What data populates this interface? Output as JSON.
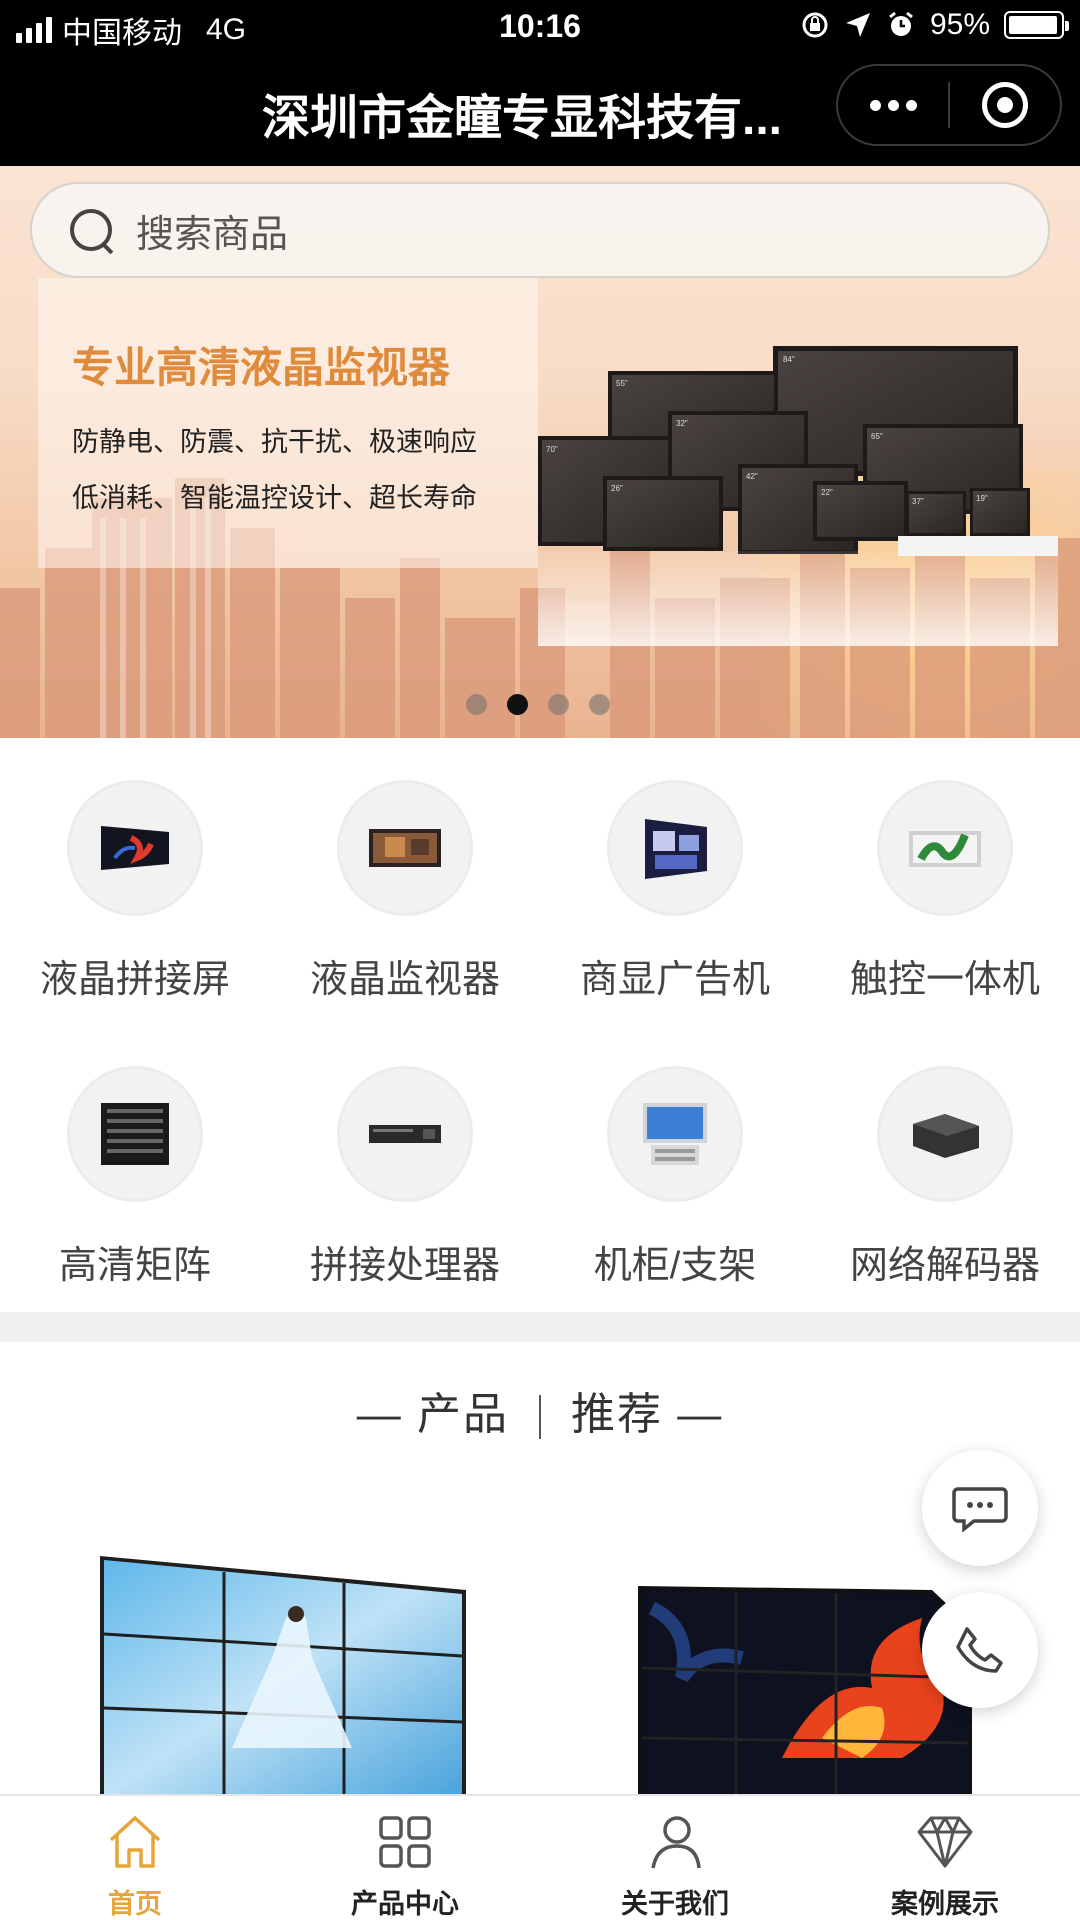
{
  "status_bar": {
    "carrier": "中国移动",
    "network": "4G",
    "time": "10:16",
    "battery_text": "95%",
    "battery_level": 0.95,
    "icons": [
      "signal-icon",
      "lock-rotation-icon",
      "location-icon",
      "alarm-icon",
      "battery-icon"
    ]
  },
  "title_bar": {
    "title": "深圳市金瞳专显科技有...",
    "menu_icon": "more-dots-icon",
    "close_icon": "target-icon"
  },
  "search": {
    "placeholder": "搜索商品",
    "icon": "search-icon"
  },
  "banner": {
    "headline": "专业高清液晶监视器",
    "line1": "防静电、防震、抗干扰、极速响应",
    "line2": "低消耗、智能温控设计、超长寿命",
    "monitor_sizes": [
      "84\"",
      "55\"",
      "32\"",
      "65\"",
      "70\"",
      "42\"",
      "26\"",
      "22\"",
      "37\"",
      "19\""
    ],
    "slide_count": 4,
    "active_slide": 2
  },
  "categories": [
    {
      "label": "液晶拼接屏",
      "icon": "lcd-splicing-screen-icon"
    },
    {
      "label": "液晶监视器",
      "icon": "lcd-monitor-icon"
    },
    {
      "label": "商显广告机",
      "icon": "ad-display-icon"
    },
    {
      "label": "触控一体机",
      "icon": "touch-all-in-one-icon"
    },
    {
      "label": "高清矩阵",
      "icon": "hd-matrix-icon"
    },
    {
      "label": "拼接处理器",
      "icon": "splicing-processor-icon"
    },
    {
      "label": "机柜/支架",
      "icon": "cabinet-bracket-icon"
    },
    {
      "label": "网络解码器",
      "icon": "network-decoder-icon"
    }
  ],
  "section": {
    "left": "— 产品",
    "right": "推荐 —"
  },
  "products": [
    {
      "name": "video-wall-product-1"
    },
    {
      "name": "video-wall-product-2"
    }
  ],
  "floating": {
    "chat_icon": "chat-bubble-icon",
    "phone_icon": "phone-icon"
  },
  "tabs": [
    {
      "label": "首页",
      "icon": "home-icon",
      "active": true
    },
    {
      "label": "产品中心",
      "icon": "grid-icon",
      "active": false
    },
    {
      "label": "关于我们",
      "icon": "user-icon",
      "active": false
    },
    {
      "label": "案例展示",
      "icon": "diamond-icon",
      "active": false
    }
  ],
  "colors": {
    "accent": "#e5a53a",
    "banner_headline": "#e08a3c",
    "header_bg": "#000000"
  }
}
